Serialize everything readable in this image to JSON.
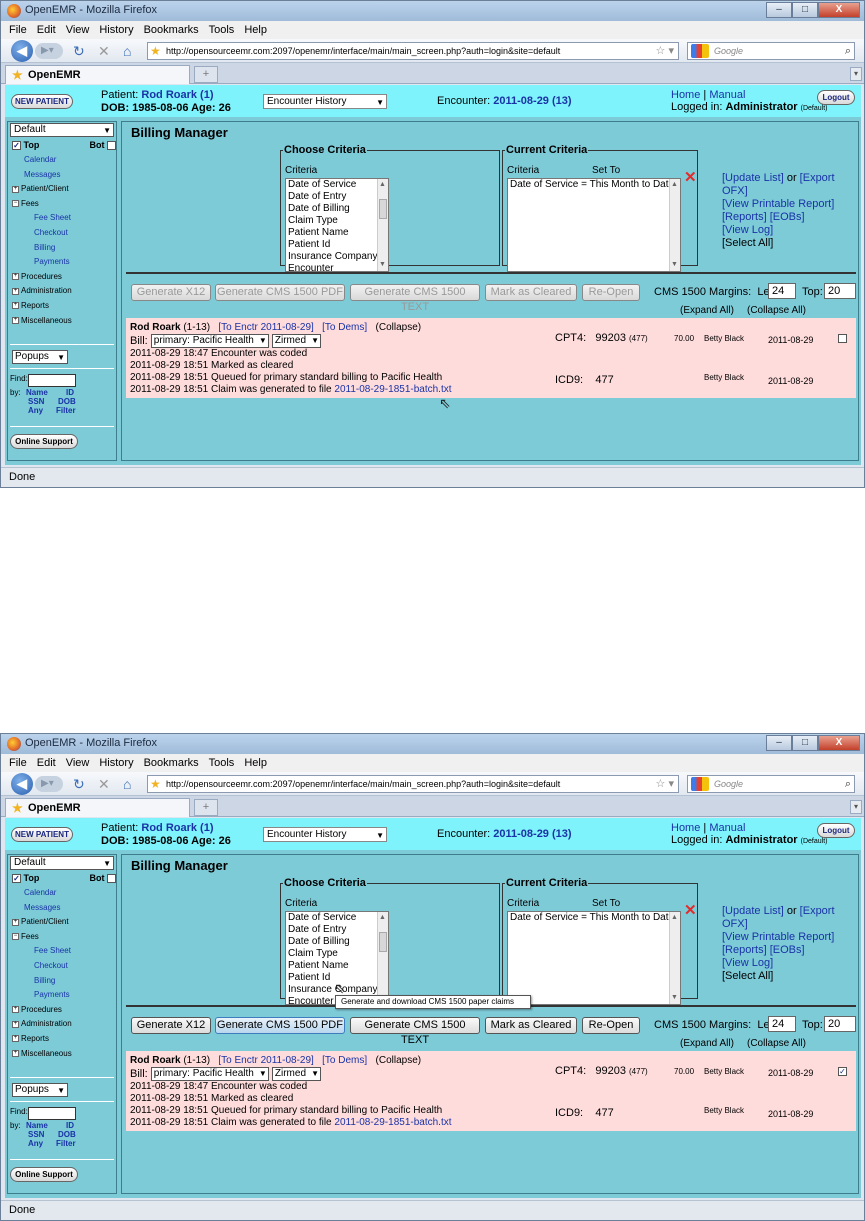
{
  "window": {
    "title": "OpenEMR - Mozilla Firefox",
    "controls": [
      "–",
      "□",
      "X"
    ]
  },
  "menu": [
    "File",
    "Edit",
    "View",
    "History",
    "Bookmarks",
    "Tools",
    "Help"
  ],
  "browser": {
    "url": "http://opensourceemr.com:2097/openemr/interface/main/main_screen.php?auth=login&site=default",
    "search_placeholder": "Google",
    "tab_title": "OpenEMR",
    "status": "Done"
  },
  "header": {
    "new_patient": "NEW PATIENT",
    "patient_label": "Patient:",
    "patient_name": "Rod Roark (1)",
    "dob_line": "DOB: 1985-08-06 Age: 26",
    "encounter_select": "Encounter History",
    "encounter_label": "Encounter:",
    "encounter_value": "2011-08-29 (13)",
    "home": "Home",
    "sep": "|",
    "manual": "Manual",
    "logged_in_label": "Logged in:",
    "user": "Administrator",
    "user_site": "(Default)",
    "logout": "Logout"
  },
  "sidebar": {
    "default_select": "Default",
    "top": "Top",
    "bot": "Bot",
    "items": {
      "calendar": "Calendar",
      "messages": "Messages",
      "patient_client": "Patient/Client",
      "fees": "Fees",
      "fee_sheet": "Fee Sheet",
      "checkout": "Checkout",
      "billing": "Billing",
      "payments": "Payments",
      "procedures": "Procedures",
      "administration": "Administration",
      "reports": "Reports",
      "miscellaneous": "Miscellaneous"
    },
    "popups": "Popups",
    "find": "Find:",
    "by": "by:",
    "name": "Name",
    "id": "ID",
    "ssn": "SSN",
    "dob": "DOB",
    "any": "Any",
    "filter": "Filter",
    "online_support": "Online Support"
  },
  "billing": {
    "title": "Billing Manager",
    "choose_legend": "Choose Criteria",
    "criteria_header": "Criteria",
    "criteria_options": [
      "Date of Service",
      "Date of Entry",
      "Date of Billing",
      "Claim Type",
      "Patient Name",
      "Patient Id",
      "Insurance Company",
      "Encounter"
    ],
    "current_legend": "Current Criteria",
    "set_to_header": "Set To",
    "current_value": "Date of Service = This Month to Date",
    "links": {
      "update_list": "[Update List]",
      "or": "or",
      "export_ofx": "[Export OFX]",
      "printable": "[View Printable Report]",
      "reports": "[Reports]",
      "eobs": "[EOBs]",
      "view_log": "[View Log]",
      "select_all": "[Select All]"
    },
    "buttons": {
      "x12": "Generate X12",
      "pdf": "Generate CMS 1500 PDF",
      "text": "Generate CMS 1500 TEXT",
      "cleared": "Mark as Cleared",
      "reopen": "Re-Open"
    },
    "margins_label": "CMS 1500 Margins:",
    "left_label": "Left:",
    "left_value": "24",
    "top_label": "Top:",
    "top_value": "20",
    "expand_all": "(Expand All)",
    "collapse_all": "(Collapse All)",
    "tooltip": "Generate and download CMS 1500 paper claims"
  },
  "claim": {
    "patient": "Rod Roark",
    "ref": "(1-13)",
    "to_encounter": "[To Enctr 2011-08-29]",
    "to_dems": "[To Dems]",
    "collapse": "(Collapse)",
    "bill_label": "Bill:",
    "bill_select": "primary: Pacific Health",
    "partner_select": "Zirmed",
    "log": [
      "2011-08-29 18:47 Encounter was coded",
      "2011-08-29 18:51 Marked as cleared",
      "2011-08-29 18:51 Queued for primary standard billing to Pacific Health"
    ],
    "claim_generated": "2011-08-29 18:51 Claim was generated to file",
    "file": "2011-08-29-1851-batch.txt",
    "cpt_label": "CPT4:",
    "cpt_code": "99203",
    "cpt_ref": "(477)",
    "amount": "70.00",
    "provider": "Betty Black",
    "date": "2011-08-29",
    "icd_label": "ICD9:",
    "icd_code": "477",
    "checked_mark": "✓"
  }
}
